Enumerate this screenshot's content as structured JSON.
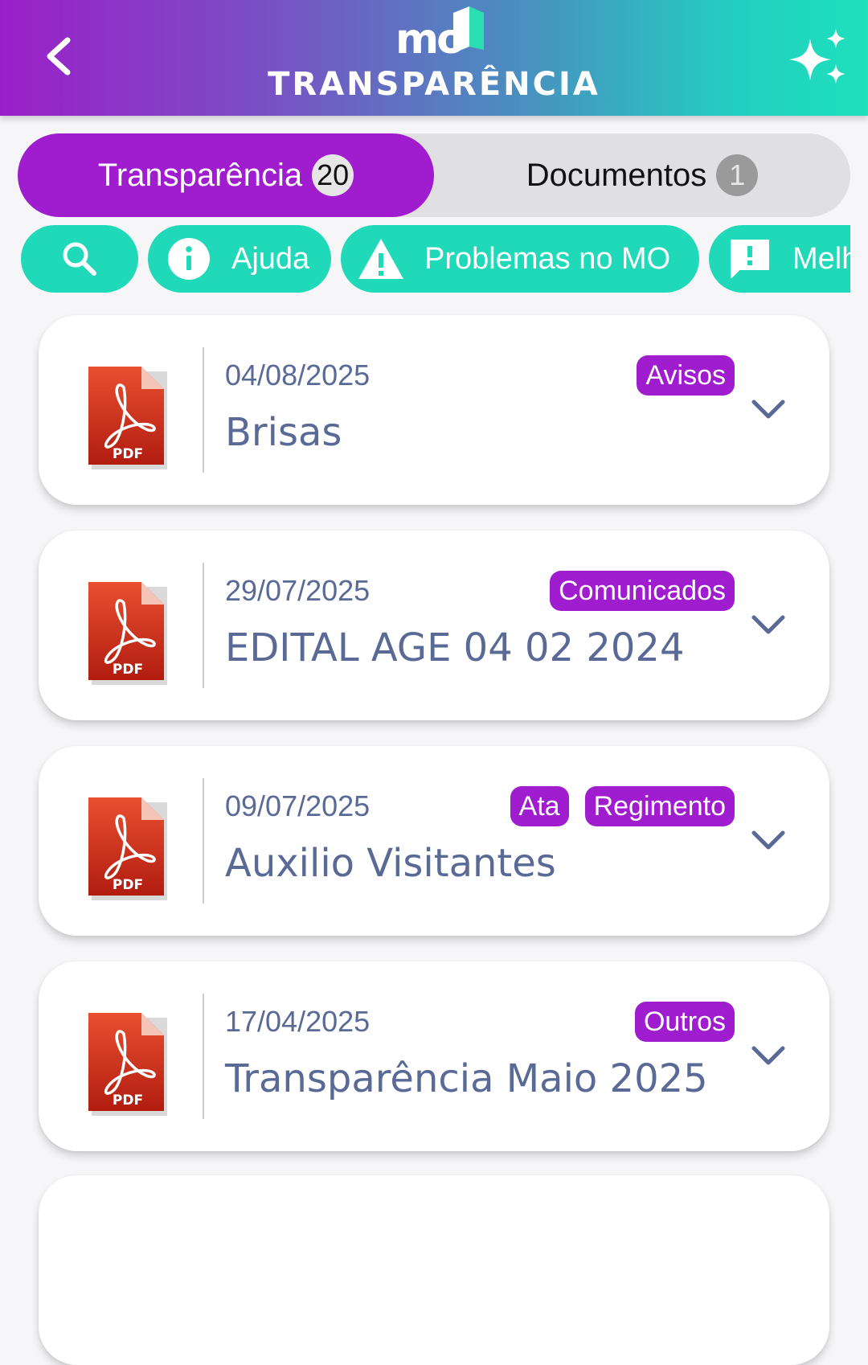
{
  "header": {
    "title": "TRANSPARÊNCIA",
    "logo_text": "mo"
  },
  "tabs": [
    {
      "label": "Transparência",
      "count": "20",
      "active": true
    },
    {
      "label": "Documentos",
      "count": "1",
      "active": false
    }
  ],
  "chips": [
    {
      "icon": "search-icon",
      "label": ""
    },
    {
      "icon": "info-icon",
      "label": "Ajuda"
    },
    {
      "icon": "warning-icon",
      "label": "Problemas no MO"
    },
    {
      "icon": "feedback-icon",
      "label": "Melhorias"
    }
  ],
  "documents": [
    {
      "date": "04/08/2025",
      "title": "Brisas",
      "tags": [
        "Avisos"
      ],
      "file_type": "PDF"
    },
    {
      "date": "29/07/2025",
      "title": "EDITAL AGE 04 02 2024",
      "tags": [
        "Comunicados"
      ],
      "file_type": "PDF"
    },
    {
      "date": "09/07/2025",
      "title": "Auxilio Visitantes",
      "tags": [
        "Ata",
        "Regimento"
      ],
      "file_type": "PDF"
    },
    {
      "date": "17/04/2025",
      "title": "Transparência Maio 2025",
      "tags": [
        "Outros"
      ],
      "file_type": "PDF"
    }
  ],
  "colors": {
    "primary_purple": "#9f1ccf",
    "accent_teal": "#1fd9b9",
    "text_blue_gray": "#5a6a96"
  }
}
